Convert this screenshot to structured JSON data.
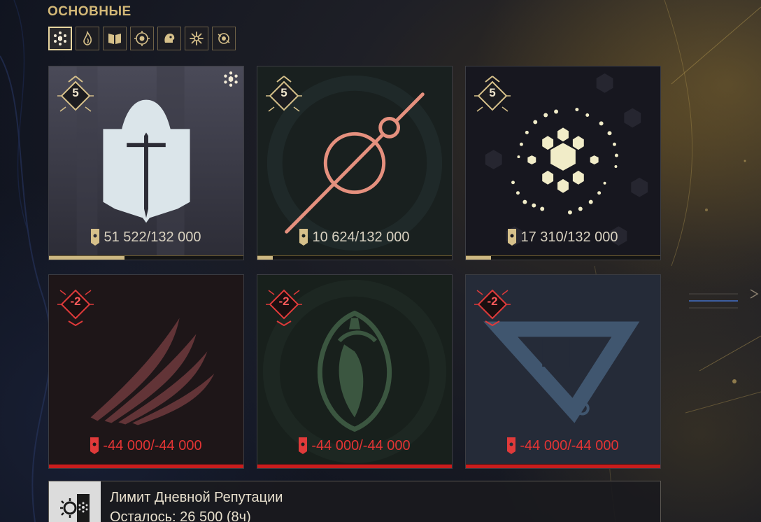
{
  "section": {
    "title": "ОСНОВНЫЕ"
  },
  "tabs": [
    {
      "icon": "hex-cluster-icon",
      "active": true
    },
    {
      "icon": "flame-icon",
      "active": false
    },
    {
      "icon": "book-icon",
      "active": false
    },
    {
      "icon": "emblem-icon",
      "active": false
    },
    {
      "icon": "head-icon",
      "active": false
    },
    {
      "icon": "starburst-icon",
      "active": false
    },
    {
      "icon": "orb-icon",
      "active": false
    }
  ],
  "cards": [
    {
      "name": "steel-meridian",
      "rank": "5",
      "standing": "51 522/132 000",
      "progress": 0.39,
      "state": "positive"
    },
    {
      "name": "arbiters-of-hexis",
      "rank": "5",
      "standing": "10 624/132 000",
      "progress": 0.08,
      "state": "positive"
    },
    {
      "name": "cephalon-suda",
      "rank": "5",
      "standing": "17 310/132 000",
      "progress": 0.13,
      "state": "positive"
    },
    {
      "name": "perrin-sequence",
      "rank": "-2",
      "standing": "-44 000/-44 000",
      "progress": 1.0,
      "state": "negative"
    },
    {
      "name": "red-veil",
      "rank": "-2",
      "standing": "-44 000/-44 000",
      "progress": 1.0,
      "state": "negative"
    },
    {
      "name": "new-loka",
      "rank": "-2",
      "standing": "-44 000/-44 000",
      "progress": 1.0,
      "state": "negative"
    }
  ],
  "daily_limit": {
    "title": "Лимит Дневной Репутации",
    "remaining": "Осталось: 26 500 (8ч)"
  },
  "colors": {
    "gold": "#cdb882",
    "red": "#e33434"
  }
}
